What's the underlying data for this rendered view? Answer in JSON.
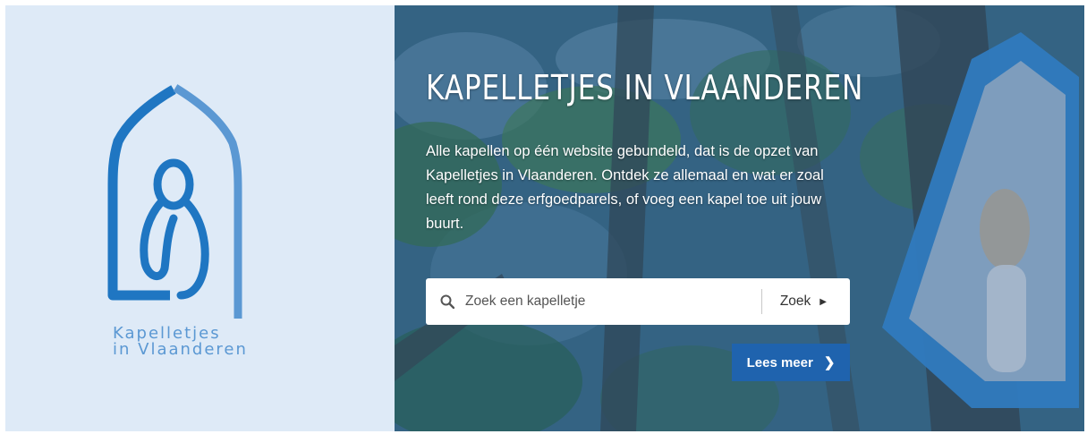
{
  "brand": {
    "logo_line1": "Kapelletjes",
    "logo_line2": "in Vlaanderen",
    "colors": {
      "panel": "#deeaf7",
      "logo_dark": "#1f76c2",
      "logo_light": "#5b98d3"
    }
  },
  "hero": {
    "title": "KAPELLETJES IN VLAANDEREN",
    "intro": "Alle kapellen op één website gebundeld, dat is de opzet van Kapelletjes in Vlaanderen. Ontdek ze allemaal en wat er zoal leeft rond deze erfgoedparels, of voeg een kapel toe uit jouw buurt."
  },
  "search": {
    "icon": "search-icon",
    "placeholder": "Zoek een kapelletje",
    "value": "",
    "button_label": "Zoek",
    "button_icon": "triangle-right-icon"
  },
  "read_more": {
    "label": "Lees meer",
    "icon": "chevron-right-icon",
    "color": "#1f63ae"
  }
}
